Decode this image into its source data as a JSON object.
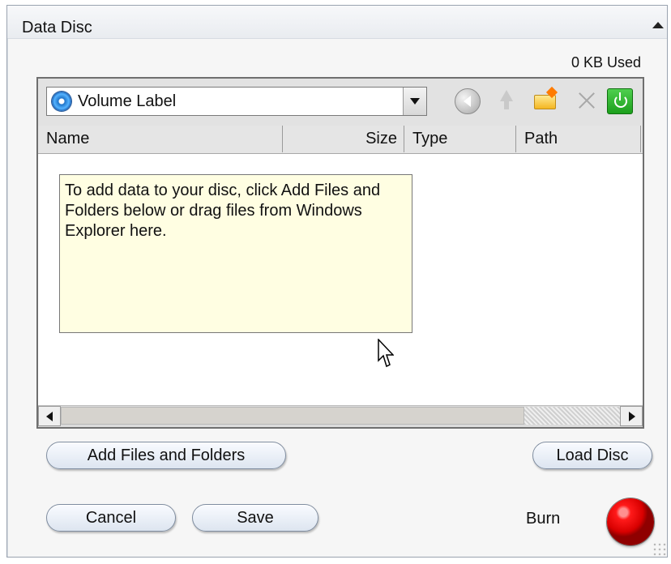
{
  "panel": {
    "title": "Data Disc",
    "used": "0 KB Used"
  },
  "toolbar": {
    "volume_label": "Volume Label",
    "icons": [
      "back-icon",
      "up-folder-icon",
      "new-folder-icon",
      "delete-icon",
      "power-icon"
    ]
  },
  "table": {
    "columns": [
      "Name",
      "Size",
      "Type",
      "Path"
    ]
  },
  "content": {
    "hint": "To add data to your disc, click Add Files and Folders below or drag files from Windows Explorer here."
  },
  "buttons": {
    "add_files_and_folders": "Add Files and Folders",
    "load_disc": "Load Disc",
    "cancel": "Cancel",
    "save": "Save",
    "burn": "Burn"
  },
  "colors": {
    "hint_background": "#fffee2",
    "burn_red": "#ff1a1a"
  }
}
